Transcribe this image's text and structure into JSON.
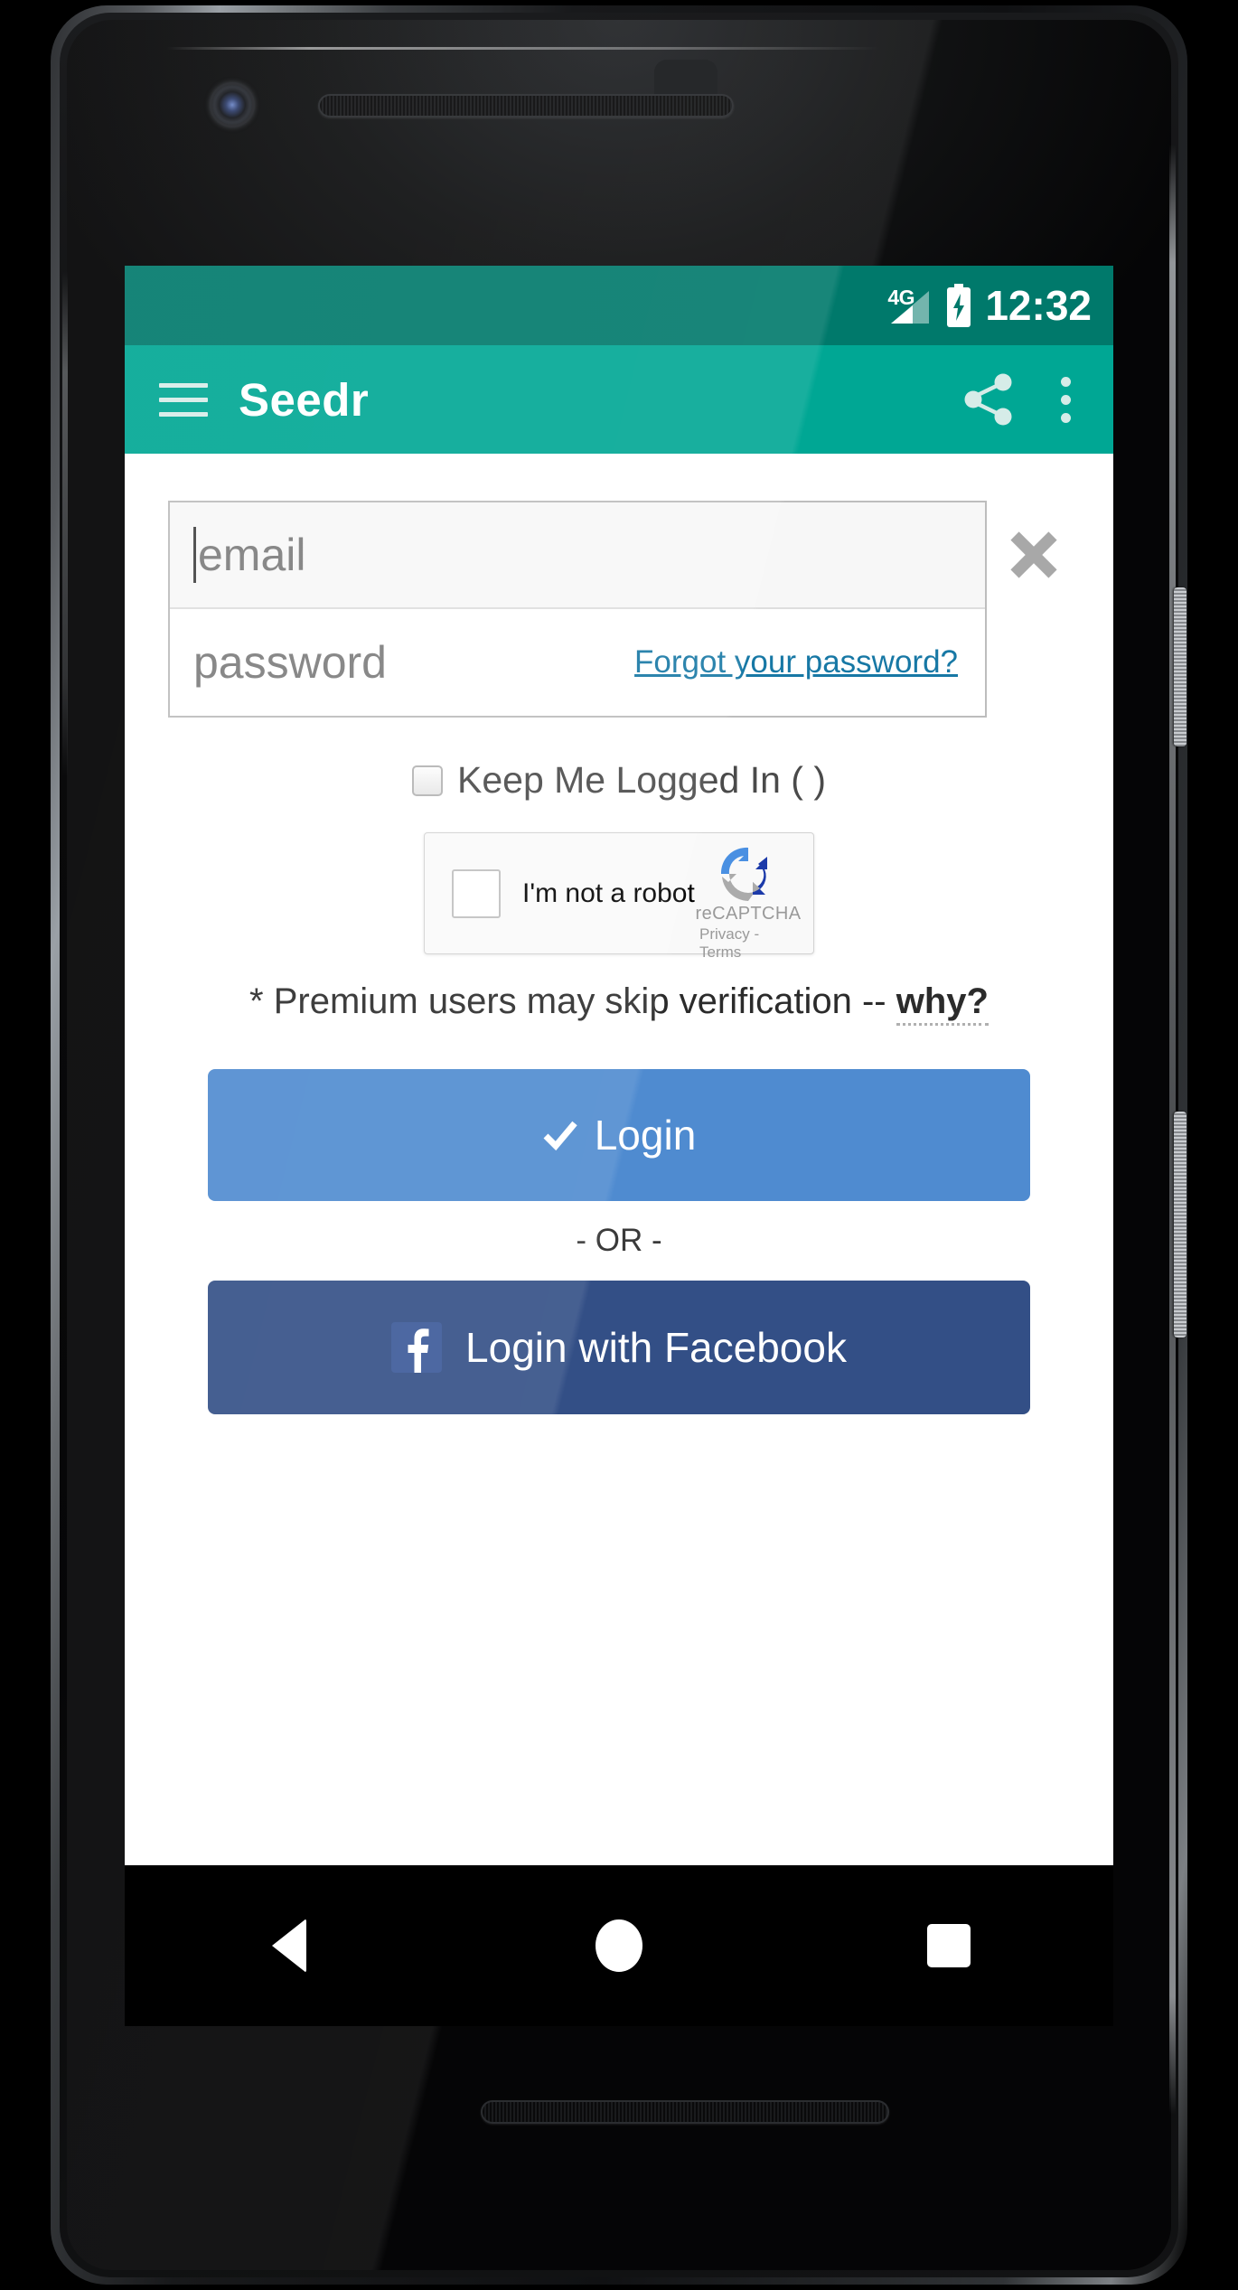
{
  "device": {
    "frame_name": "android-phone-frame",
    "camera": "front-camera",
    "earpiece": "earpiece-speaker",
    "bottom_speaker": "bottom-speaker"
  },
  "status_bar": {
    "network_label": "4G",
    "signal_icon": "signal-bars-icon",
    "battery_icon": "battery-charging-icon",
    "time": "12:32",
    "background_color": "#00796b"
  },
  "app_bar": {
    "menu_icon": "hamburger-menu-icon",
    "title": "Seedr",
    "share_icon": "share-icon",
    "overflow_icon": "more-vertical-icon",
    "background_color": "#00a794"
  },
  "login_form": {
    "email": {
      "placeholder": "email",
      "value": "",
      "focused": true
    },
    "password": {
      "placeholder": "password",
      "value": ""
    },
    "forgot_link": "Forgot your password?",
    "close_icon": "close-x-icon",
    "keep_logged_in": {
      "label": "Keep Me Logged In ( )",
      "checked": false
    },
    "recaptcha": {
      "checkbox_label": "I'm not a robot",
      "checked": false,
      "brand": "reCAPTCHA",
      "terms": "Privacy - Terms",
      "logo_icon": "recaptcha-logo-icon"
    },
    "premium_note": "* Premium users may skip verification -- ",
    "premium_why": "why?",
    "login_button": {
      "label": "Login",
      "icon": "check-icon",
      "color": "#4f8bd0"
    },
    "or_divider": "- OR -",
    "facebook_button": {
      "label": "Login with Facebook",
      "icon": "facebook-f-icon",
      "color": "#334f86"
    }
  },
  "nav_bar": {
    "back": "back-triangle-icon",
    "home": "home-circle-icon",
    "recents": "recents-square-icon"
  }
}
